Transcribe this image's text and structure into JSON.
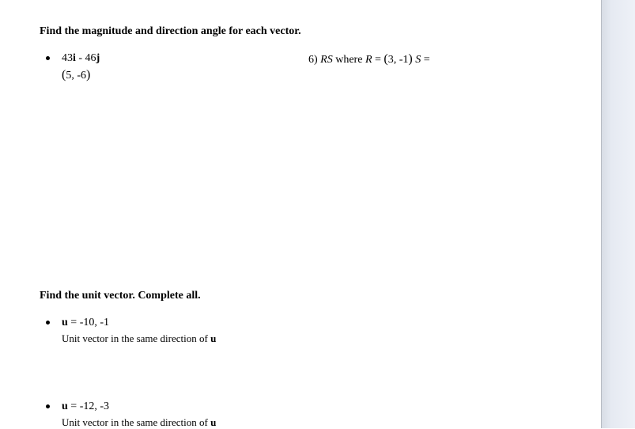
{
  "section1": {
    "heading": "Find the magnitude and direction angle for each vector.",
    "item1": {
      "expr_part1": "43",
      "expr_i": "i",
      "expr_mid": " - 46",
      "expr_j": "j",
      "line2_open": "(",
      "line2_val": "5, -6",
      "line2_close": ")"
    },
    "item6": {
      "num": "6)  ",
      "rs": "RS",
      "where": " where ",
      "R": "R",
      "eq1": " = ",
      "paren_open": "(",
      "rval": "3, -1",
      "paren_close": ")",
      "space": "  ",
      "S": "S",
      "eq2": " ="
    }
  },
  "section2": {
    "heading": "Find the unit vector. Complete all.",
    "itemA": {
      "u": "u",
      "eq": " =  ",
      "val": "-10, -1",
      "desc_pre": "Unit vector in the same direction of ",
      "desc_u": "u"
    },
    "itemB": {
      "u": "u",
      "eq": " =   ",
      "val": "-12, -3",
      "desc_pre": "Unit vector in the same direction of ",
      "desc_u": "u"
    }
  }
}
